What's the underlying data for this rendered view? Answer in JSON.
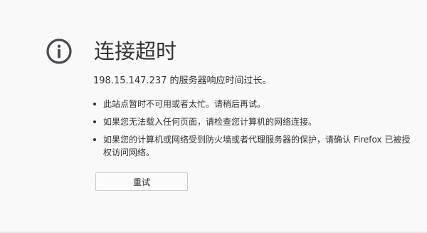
{
  "error": {
    "title": "连接超时",
    "description": "198.15.147.237 的服务器响应时间过长。",
    "suggestions": [
      "此站点暂时不可用或者太忙。请稍后再试。",
      "如果您无法载入任何页面，请检查您计算机的网络连接。",
      "如果您的计算机或网络受到防火墙或者代理服务器的保护，请确认 Firefox 已被授权访问网络。"
    ],
    "retry_label": "重试"
  },
  "icons": {
    "info": "info-circle-icon"
  },
  "colors": {
    "background": "#f9f9fa",
    "text": "#333333",
    "icon": "#4a4a4f",
    "button_border": "#c9c9c9"
  }
}
